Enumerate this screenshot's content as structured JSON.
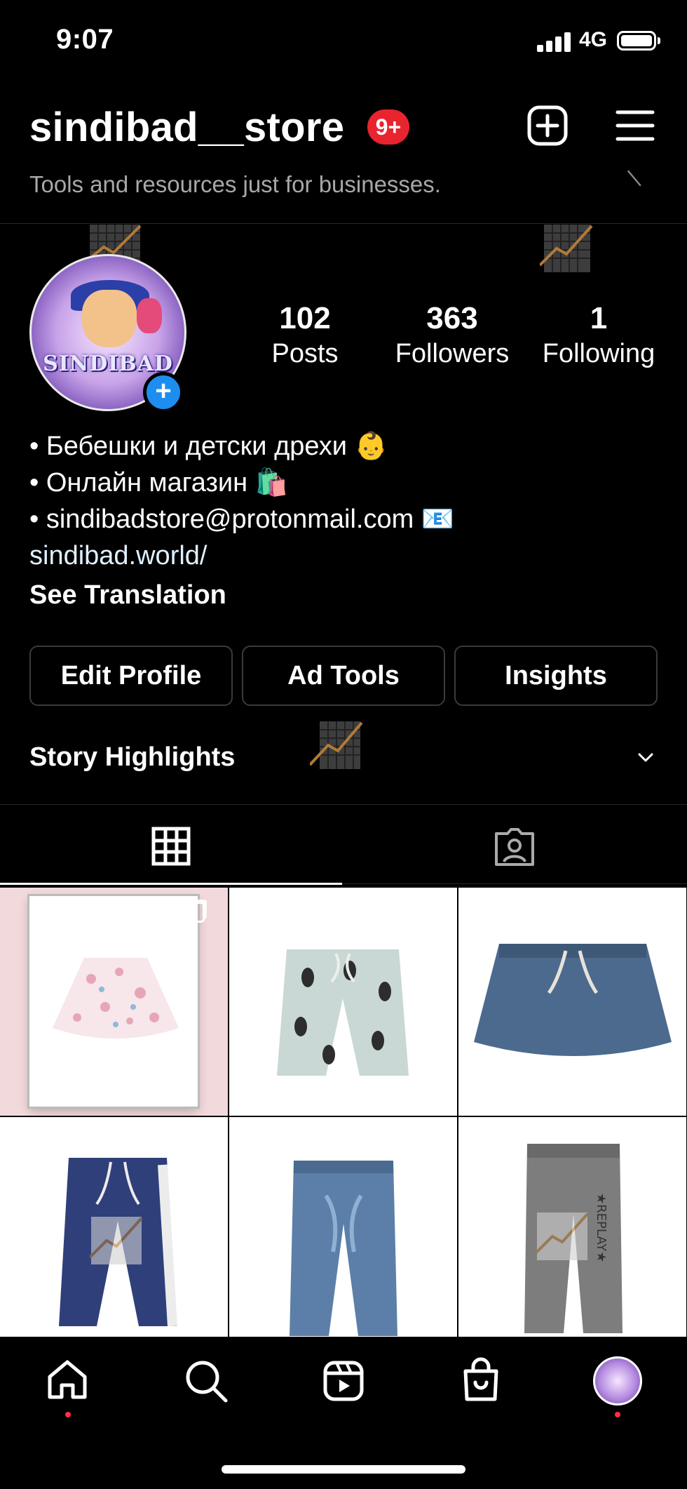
{
  "status_bar": {
    "time": "9:07",
    "network": "4G"
  },
  "header": {
    "username": "sindibad__store",
    "notification_badge": "9+",
    "banner_text": "Tools and resources just for businesses."
  },
  "profile": {
    "avatar_text": "SINDIBAD",
    "stats": [
      {
        "value": "102",
        "label": "Posts"
      },
      {
        "value": "363",
        "label": "Followers"
      },
      {
        "value": "1",
        "label": "Following"
      }
    ],
    "bio": [
      "• Бебешки и детски дрехи 👶",
      "• Онлайн магазин 🛍️",
      "• sindibadstore@protonmail.com 📧"
    ],
    "link": "sindibad.world/",
    "see_translation": "See Translation"
  },
  "buttons": {
    "edit_profile": "Edit Profile",
    "ad_tools": "Ad Tools",
    "insights": "Insights"
  },
  "story_highlights": "Story Highlights",
  "tabs": [
    "grid",
    "tagged"
  ],
  "grid_posts": [
    {
      "item": "floral skirt",
      "multi": true,
      "colors": [
        "#f2d9dc",
        "#ffffff",
        "#e7a6b7"
      ]
    },
    {
      "item": "penguin shorts",
      "multi": false,
      "colors": [
        "#ffffff",
        "#c9d8d4"
      ]
    },
    {
      "item": "navy skort",
      "multi": false,
      "colors": [
        "#ffffff",
        "#4c6a8e"
      ]
    },
    {
      "item": "navy joggers",
      "multi": true,
      "colors": [
        "#ffffff",
        "#2f3f7a"
      ]
    },
    {
      "item": "denim jeans",
      "multi": false,
      "colors": [
        "#ffffff",
        "#5b7fa8"
      ]
    },
    {
      "item": "grey joggers",
      "multi": false,
      "colors": [
        "#ffffff",
        "#7d7d7d"
      ]
    }
  ],
  "bottom_nav": [
    "home",
    "search",
    "reels",
    "shop",
    "profile"
  ],
  "colors": {
    "badge": "#e8242f",
    "accent_blue": "#1d8ef0",
    "nav_dot": "#ff3040"
  }
}
